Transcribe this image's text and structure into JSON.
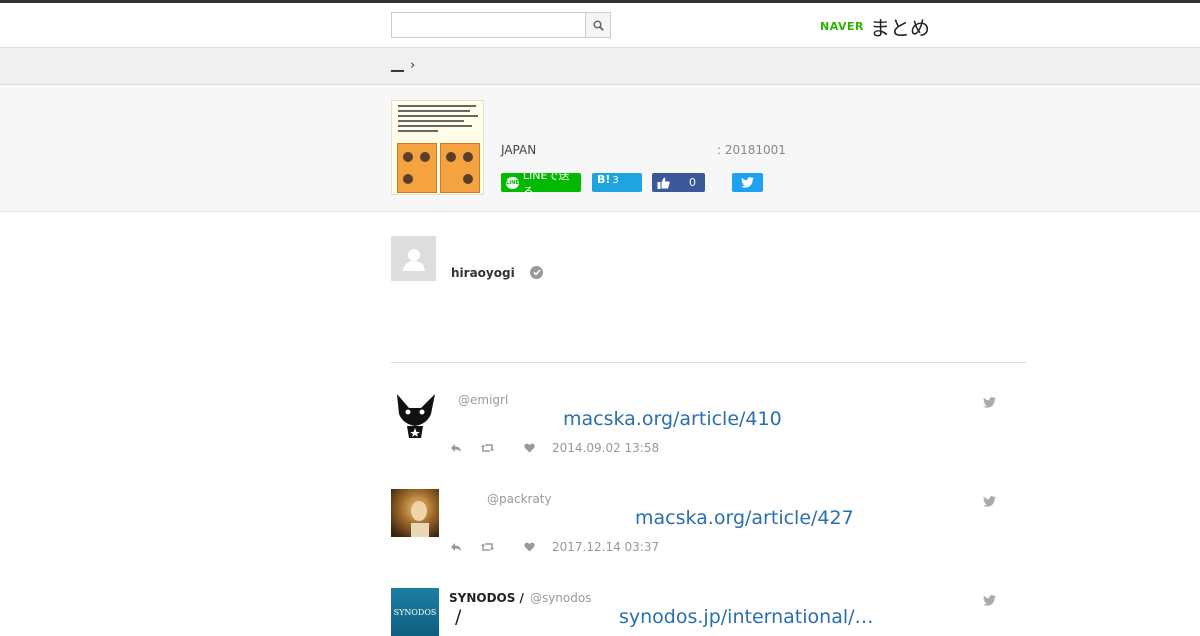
{
  "header": {
    "search_placeholder": "",
    "logo_brand": "NAVER",
    "logo_name": "まとめ"
  },
  "breadcrumb": {
    "item": "__",
    "separator": "›"
  },
  "summary": {
    "organization": "JAPAN",
    "date": ": 20181001",
    "share": {
      "line_label": "LINEで送る",
      "hatena_label": "B!",
      "hatena_count": "3",
      "facebook_count": "0"
    }
  },
  "author": {
    "name": "hiraoyogi"
  },
  "tweets": [
    {
      "display_name": "",
      "handle": "@emigrl",
      "prefix": "",
      "link": "macska.org/article/410",
      "timestamp": "2014.09.02 13:58"
    },
    {
      "display_name": "",
      "handle": "@packraty",
      "prefix": "",
      "link": "macska.org/article/427",
      "timestamp": "2017.12.14 03:37"
    },
    {
      "display_name": "SYNODOS /",
      "handle": "@synodos",
      "prefix": "/",
      "link": "synodos.jp/international/…",
      "timestamp": ""
    }
  ],
  "colors": {
    "line_green": "#00b900",
    "hatena_blue": "#20a4de",
    "facebook_blue": "#3b5998",
    "twitter_blue": "#1da1f2",
    "link_blue": "#2a6eb0",
    "naver_green": "#2db400"
  }
}
